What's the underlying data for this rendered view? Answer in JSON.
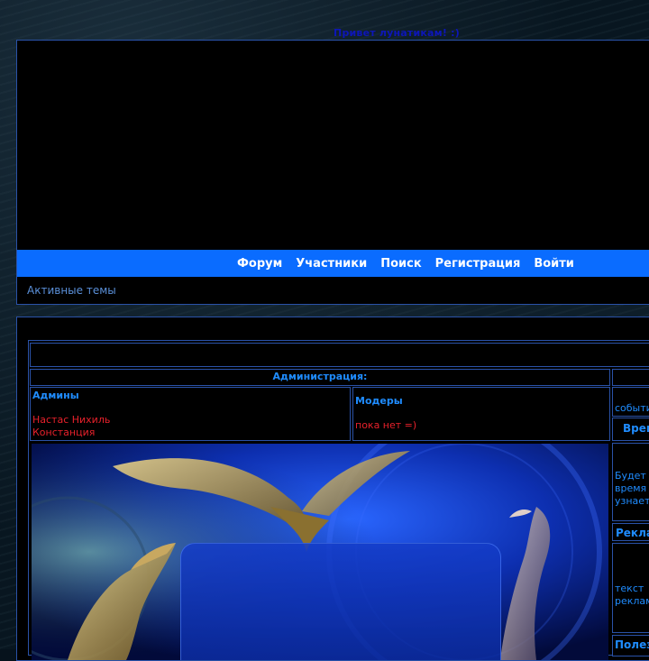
{
  "greeting": "Привет лунатикам! :)",
  "nav": {
    "items": [
      {
        "label": "Форум"
      },
      {
        "label": "Участники"
      },
      {
        "label": "Поиск"
      },
      {
        "label": "Регистрация"
      },
      {
        "label": "Войти"
      }
    ]
  },
  "subnav": {
    "active_topics": "Активные темы"
  },
  "admin": {
    "heading": "Администрация:",
    "admins_label": "Админы",
    "admins": [
      "Настас Нихиль",
      "Констанция"
    ],
    "mods_label": "Модеры",
    "mods_value": "пока нет =)"
  },
  "sidebar": {
    "events_fragment": "событи",
    "time_heading": "Врем",
    "time_text": [
      "Будет",
      "время",
      "узнает"
    ],
    "ads_heading": "Рекла",
    "ads_text": [
      "текст",
      "реклам"
    ],
    "useful_heading": "Полез"
  },
  "colors": {
    "nav_bar": "#0a6cff",
    "border": "#2a52a8",
    "accent_blue": "#1f8cff",
    "name_red": "#e8212b"
  }
}
